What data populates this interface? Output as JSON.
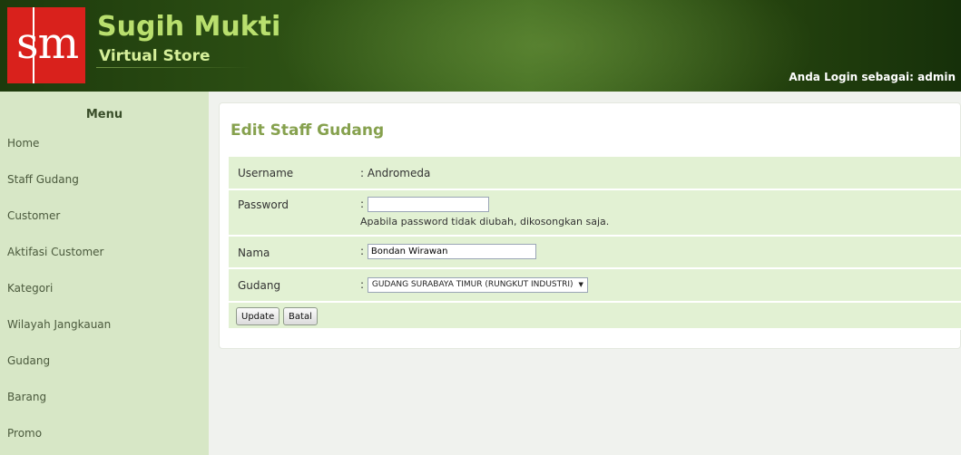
{
  "header": {
    "logo_text": "sm",
    "brand_title": "Sugih Mukti",
    "brand_subtitle": "Virtual Store",
    "login_info": "Anda Login sebagai: admin"
  },
  "sidebar": {
    "title": "Menu",
    "items": [
      {
        "label": "Home"
      },
      {
        "label": "Staff Gudang"
      },
      {
        "label": "Customer"
      },
      {
        "label": "Aktifasi Customer"
      },
      {
        "label": "Kategori"
      },
      {
        "label": "Wilayah Jangkauan"
      },
      {
        "label": "Gudang"
      },
      {
        "label": "Barang"
      },
      {
        "label": "Promo"
      }
    ]
  },
  "form": {
    "title": "Edit Staff Gudang",
    "username_label": "Username",
    "username_value": ": Andromeda",
    "password_label": "Password",
    "password_colon": ":",
    "password_value": "",
    "password_hint": "Apabila password tidak diubah, dikosongkan saja.",
    "nama_label": "Nama",
    "nama_colon": ":",
    "nama_value": "Bondan Wirawan",
    "gudang_label": "Gudang",
    "gudang_colon": ":",
    "gudang_selected": "GUDANG SURABAYA TIMUR (RUNGKUT INDUSTRI)",
    "update_label": "Update",
    "cancel_label": "Batal"
  },
  "colors": {
    "accent_title": "#86a14e",
    "sidebar_bg": "#d7e7c6",
    "form_row_bg": "#e2f1d3",
    "logo_red": "#d9211c"
  }
}
